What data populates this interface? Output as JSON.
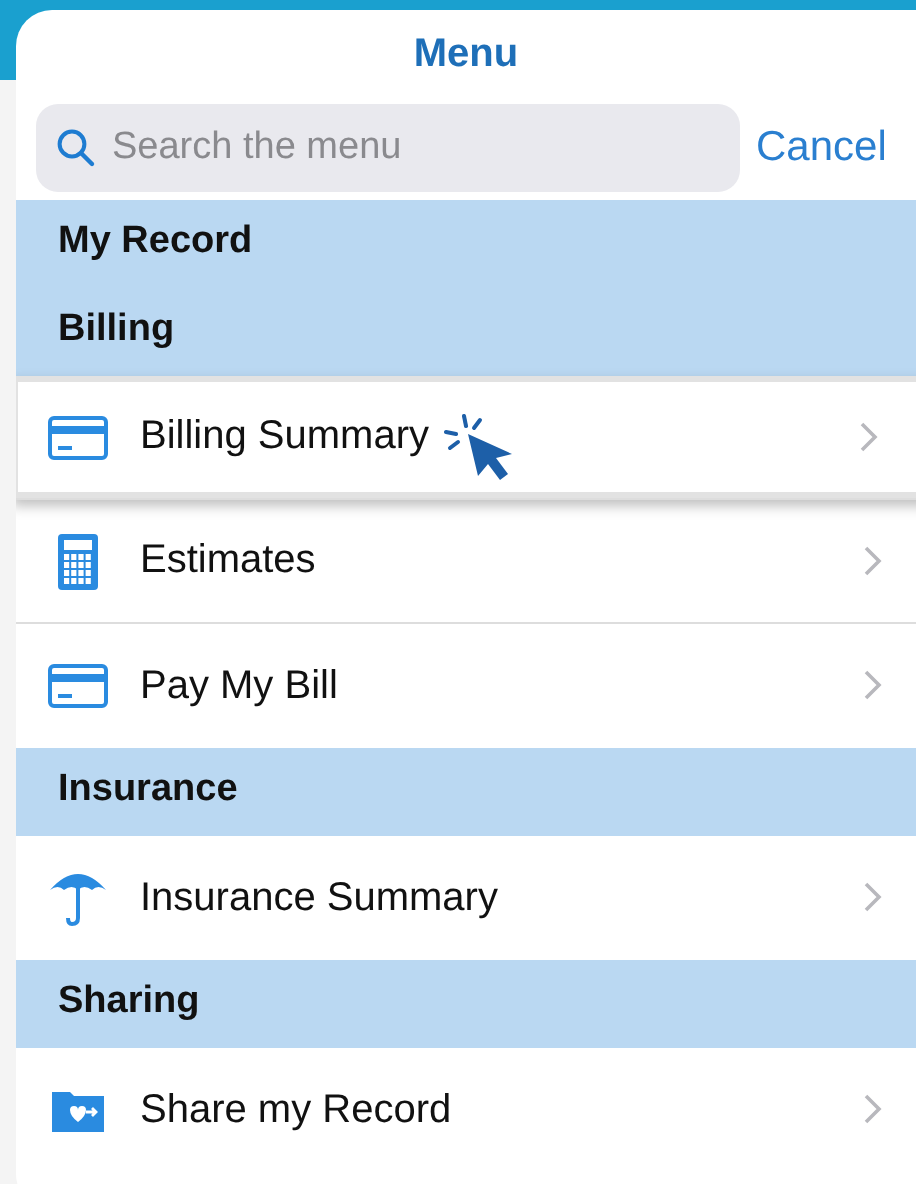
{
  "title": "Menu",
  "search": {
    "placeholder": "Search the menu"
  },
  "cancel": "Cancel",
  "sections": [
    {
      "title": "My Record"
    },
    {
      "title": "Billing",
      "items": [
        {
          "label": "Billing Summary",
          "kind": "card",
          "selected": true
        },
        {
          "label": "Estimates",
          "kind": "calculator",
          "selected": false
        },
        {
          "label": "Pay My Bill",
          "kind": "card",
          "selected": false
        }
      ]
    },
    {
      "title": "Insurance",
      "items": [
        {
          "label": "Insurance Summary",
          "kind": "umbrella",
          "selected": false
        }
      ]
    },
    {
      "title": "Sharing",
      "items": [
        {
          "label": "Share my Record",
          "kind": "folder",
          "selected": false
        }
      ]
    }
  ]
}
